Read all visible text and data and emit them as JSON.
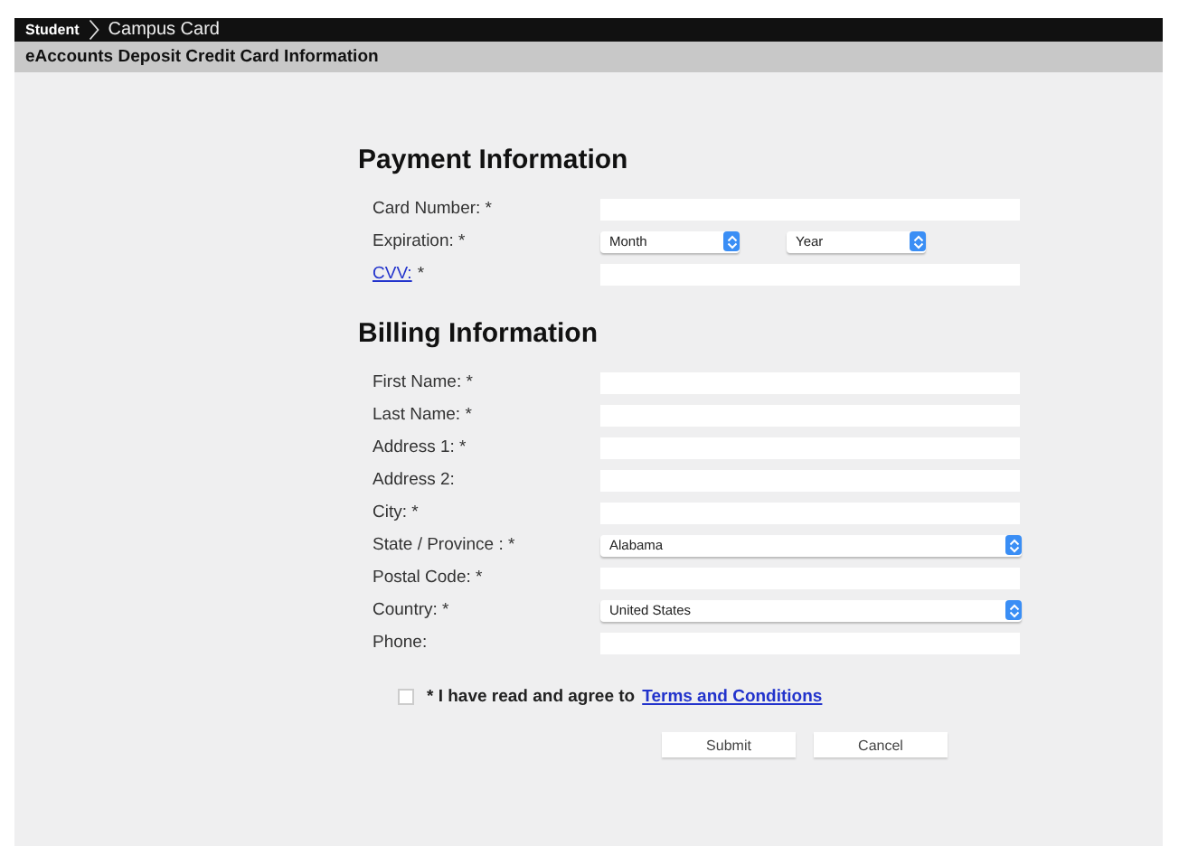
{
  "breadcrumb": [
    {
      "label": "Student",
      "kind": "root"
    },
    {
      "label": "Campus Card",
      "kind": "current"
    }
  ],
  "page_title": "eAccounts Deposit Credit Card Information",
  "sections": [
    {
      "heading": "Payment Information",
      "rows": [
        {
          "label": "Card Number: *",
          "kind": "text"
        },
        {
          "label": "Expiration: *",
          "kind": "pair",
          "selects": [
            "Month",
            "Year"
          ]
        },
        {
          "link": "CVV:",
          "label": "*",
          "kind": "text"
        }
      ]
    },
    {
      "heading": "Billing Information",
      "rows": [
        {
          "label": "First Name: *",
          "kind": "text"
        },
        {
          "label": "Last Name: *",
          "kind": "text"
        },
        {
          "label": "Address 1: *",
          "kind": "text"
        },
        {
          "label": "Address 2:",
          "kind": "text"
        },
        {
          "label": "City: *",
          "kind": "text"
        },
        {
          "label": "State / Province : *",
          "kind": "select",
          "selects": [
            "Alabama"
          ]
        },
        {
          "label": "Postal Code: *",
          "kind": "text"
        },
        {
          "label": "Country: *",
          "kind": "select",
          "selects": [
            "United States"
          ]
        },
        {
          "label": "Phone:",
          "kind": "text"
        }
      ]
    }
  ],
  "agreement": {
    "text": "* I have read and agree to",
    "link": "Terms and Conditions",
    "checked": false
  },
  "buttons": [
    "Submit",
    "Cancel"
  ]
}
